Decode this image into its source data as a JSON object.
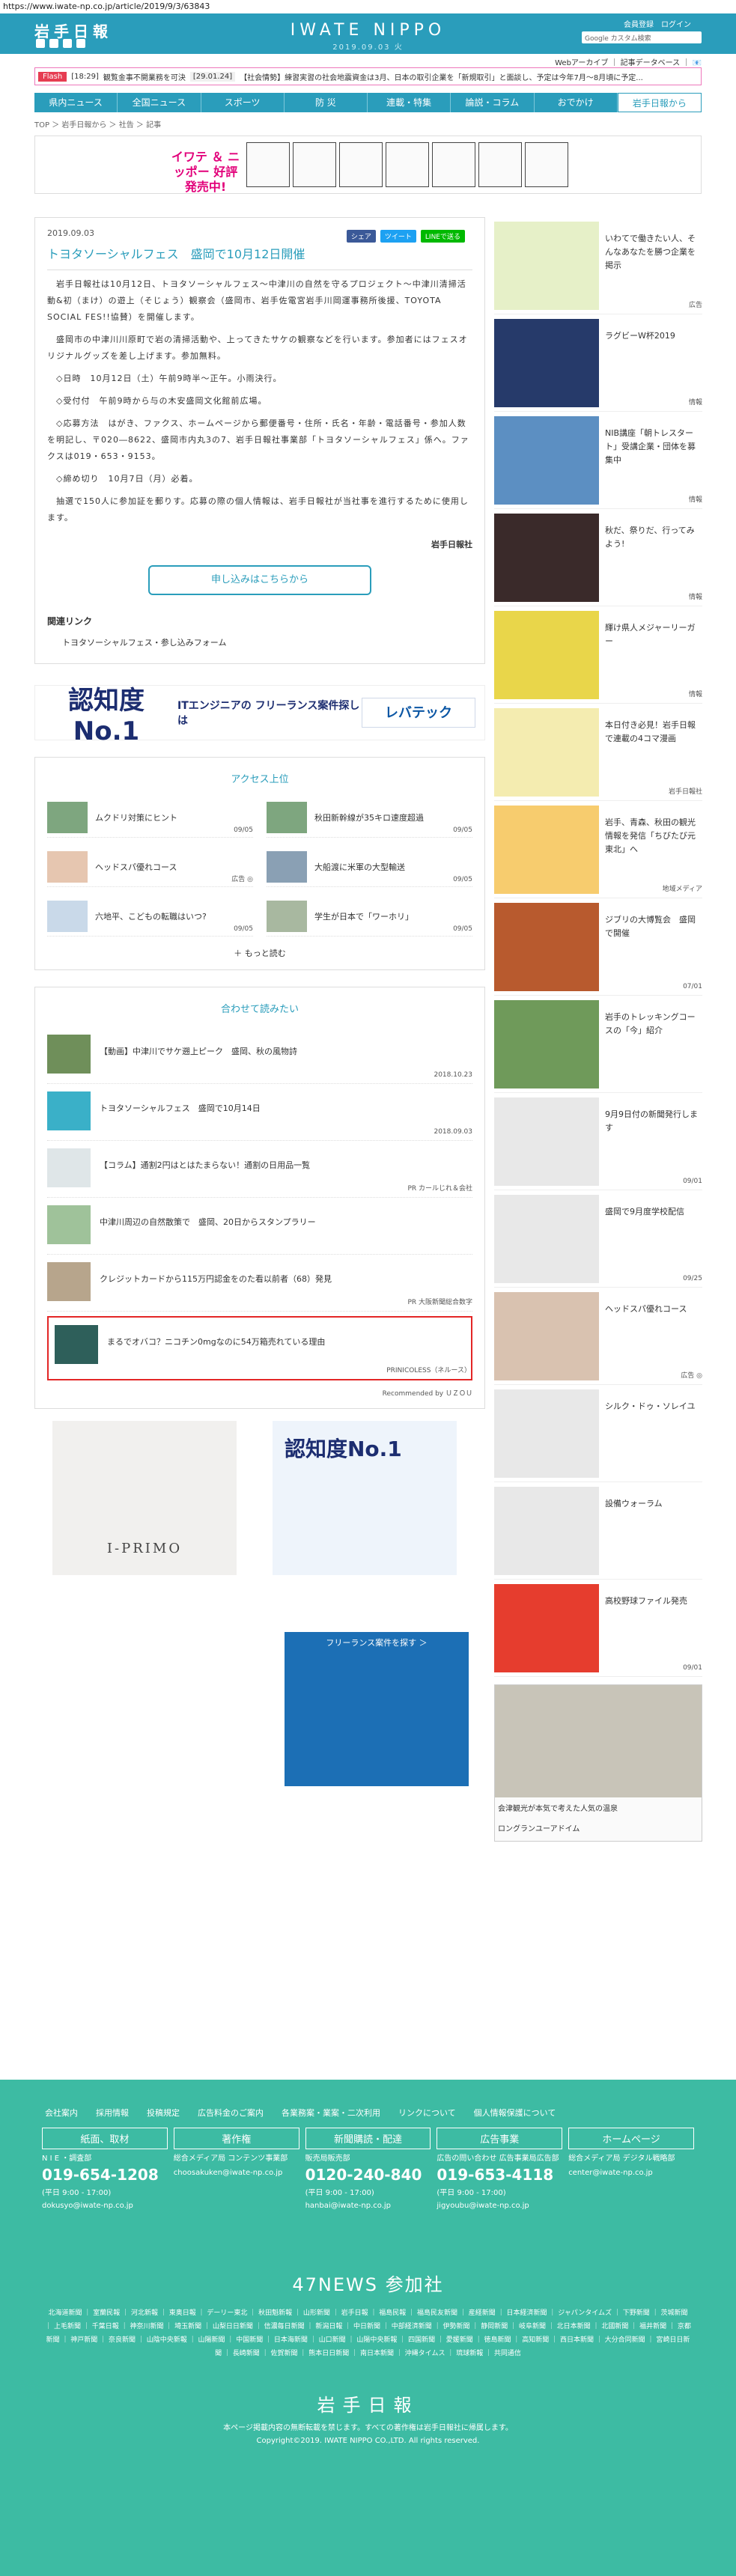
{
  "url": "https://www.iwate-np.co.jp/article/2019/9/3/63843",
  "header": {
    "logo": "岩手日報",
    "title": "IWATE NIPPO",
    "date": "2019.09.03 火",
    "login": "会員登録",
    "logout": "ログイン",
    "search_placeholder": "Google カスタム検索",
    "sub_links": "Webアーカイブ ｜ 記事データベース ｜ 📧"
  },
  "flash": {
    "tag": "Flash",
    "time": "[18:29]",
    "text": "観覧金事不開業務を可決",
    "time2": "[29.01.24]",
    "text2": "【社会情勢】練習実習の社会地震資金は3月、日本の取引企業を「新規取引」と面談し、予定は今年7月〜8月頃に予定..."
  },
  "nav": [
    "県内ニュース",
    "全国ニュース",
    "スポーツ",
    "防 災",
    "連載・特集",
    "論説・コラム",
    "おでかけ",
    "岩手日報から"
  ],
  "breadcrumb": "TOP ＞ 岩手日報から ＞ 社告 ＞ 記事",
  "banner": {
    "title": "イワテ ＆ ニッポー 好評発売中!"
  },
  "article": {
    "date": "2019.09.03",
    "share_fb": "シェア",
    "share_tw": "ツイート",
    "share_line": "LINEで送る",
    "title": "トヨタソーシャルフェス　盛岡で10月12日開催",
    "p1": "　岩手日報社は10月12日、トヨタソーシャルフェス〜中津川の自然を守るプロジェクト〜中津川清掃活動&初（まけ）の遊上（そじょう）観察会（盛岡市、岩手佐電宮岩手川岡運事務所後援、TOYOTA SOCIAL FES!!協賛）を開催します。",
    "p2": "　盛岡市の中津川川原町で岩の清掃活動や、上ってきたサケの観察などを行います。参加者にはフェスオリジナルグッズを差し上げます。参加無料。",
    "p3": "　◇日時　10月12日（土）午前9時半〜正午。小雨決行。",
    "p4": "　◇受付付　午前9時から与の木安盛岡文化館前広場。",
    "p5": "　◇応募方法　はがき、ファクス、ホームページから郵便番号・住所・氏名・年齢・電話番号・参加人数を明記し、〒020―8622、盛岡市内丸3の7、岩手日報社事業部「トヨタソーシャルフェス」係へ。ファクスは019・653・9153。",
    "p6": "　◇締め切り　10月7日（月）必着。",
    "p7": "　抽選で150人に参加証を郵りす。応募の際の個人情報は、岩手日報社が当社事を進行するために使用します。",
    "signature": "岩手日報社",
    "apply_button": "申し込みはこちらから",
    "related_heading": "関連リンク",
    "related_link": "トヨタソーシャルフェス・参し込みフォーム"
  },
  "ad_wide": {
    "no1_label": "認知度No.1",
    "mid": "ITエンジニアの フリーランス案件探しは",
    "logo": "レバテック"
  },
  "access": {
    "heading": "アクセス上位",
    "items": [
      {
        "title": "ムクドリ対策にヒント",
        "date": "09/05"
      },
      {
        "title": "秋田新幹線が35キロ速度超過",
        "date": "09/05"
      },
      {
        "title": "ヘッドスパ優れコース",
        "date": "広告 ◎"
      },
      {
        "title": "大船渡に米軍の大型輸送",
        "date": "09/05"
      },
      {
        "title": "六地平、こどもの転職はいつ?",
        "date": "09/05"
      },
      {
        "title": "学生が日本で「ワーホリ」",
        "date": "09/05"
      }
    ],
    "more": "もっと読む"
  },
  "recommend": {
    "heading": "合わせて読みたい",
    "items": [
      {
        "title": "【動画】中津川でサケ遡上ピーク　盛岡、秋の風物詩",
        "date": "2018.10.23"
      },
      {
        "title": "トヨタソーシャルフェス　盛岡で10月14日",
        "date": "2018.09.03"
      },
      {
        "title": "【コラム】通割2円はとはたまらない！通割の日用品一覧",
        "date": "PR カールじれ＆会社"
      },
      {
        "title": "中津川周辺の自然散策で　盛岡、20日からスタンプラリー",
        "date": ""
      },
      {
        "title": "クレジットカードから115万円認金をのた看以前者（68）発見",
        "date": "PR 大阪新聞総合数字"
      },
      {
        "title": "まるでオバコ？ニコチン0mgなのに54万箱売れている理由",
        "date": "PRINICOLESS（ネルース）"
      }
    ],
    "footer": "Recommended by ＵＺＯＵ"
  },
  "bottom_ads": {
    "primo": "I-PRIMO",
    "lev_no1": "認知度No.1",
    "lev_btn": "フリーランス案件を探す ＞"
  },
  "sidebar": [
    {
      "title": "いわてで働きたい人、そんなあなたを勝つ企業を掲示",
      "date": "広告"
    },
    {
      "title": "ラグビーW杯2019",
      "date": "情報"
    },
    {
      "title": "NIB講座「朝トレスタート」受講企業・団体を募集中",
      "date": "情報"
    },
    {
      "title": "秋だ、祭りだ、行ってみよう!",
      "date": "情報"
    },
    {
      "title": "輝け県人メジャーリーガー",
      "date": "情報"
    },
    {
      "title": "本日付き必見！岩手日報で連載の4コマ漫画",
      "date": "岩手日報社"
    },
    {
      "title": "岩手、青森、秋田の観光情報を発信「ちびたび元東北」へ",
      "date": "地域メディア"
    },
    {
      "title": "ジブリの大博覧会　盛岡で開催",
      "date": "07/01"
    },
    {
      "title": "岩手のトレッキングコースの「今」紹介",
      "date": ""
    },
    {
      "title": "9月9日付の新聞発行します",
      "date": "09/01"
    },
    {
      "title": "盛岡で9月度学校配信",
      "date": "09/25"
    },
    {
      "title": "ヘッドスパ優れコース",
      "date": "広告 ◎"
    },
    {
      "title": "シルク・ドゥ・ソレイユ",
      "date": ""
    },
    {
      "title": "設備ウォーラム",
      "date": ""
    },
    {
      "title": "高校野球ファイル発売",
      "date": "09/01"
    }
  ],
  "side_ad": {
    "caption": "会津観光が本気で考えた人気の温泉",
    "src": "ロングランユーアドイム"
  },
  "footer": {
    "links": [
      "会社案内",
      "採用情報",
      "投稿規定",
      "広告料金のご案内",
      "各業務案・業案・二次利用",
      "リンクについて",
      "個人情報保護について"
    ],
    "cols": [
      {
        "head": "紙面、取材",
        "sub": "N I E ・調査部",
        "tel": "019-654-1208",
        "hours": "(平日 9:00 - 17:00)",
        "mail": "dokusyo@iwate-np.co.jp"
      },
      {
        "head": "著作権",
        "sub": "総合メディア局 コンテンツ事業部",
        "tel": "",
        "hours": "",
        "mail": "choosakuken@iwate-np.co.jp"
      },
      {
        "head": "新聞購読・配達",
        "sub": "販売局販売部",
        "tel": "0120-240-840",
        "hours": "(平日 9:00 - 17:00)",
        "mail": "hanbai@iwate-np.co.jp"
      },
      {
        "head": "広告事業",
        "sub": "広告の問い合わせ 広告事業局広告部",
        "tel": "019-653-4118",
        "hours": "(平日 9:00 - 17:00)",
        "mail": "jigyoubu@iwate-np.co.jp"
      },
      {
        "head": "ホームページ",
        "sub": "総合メディア局 デジタル戦略部",
        "tel": "",
        "hours": "",
        "mail": "center@iwate-np.co.jp"
      }
    ],
    "f47": "47NEWS 参加社",
    "papers": "北海道新聞 ｜ 室蘭民報 ｜ 河北新報 ｜ 東奥日報 ｜ デーリー東北 ｜ 秋田魁新報 ｜ 山形新聞 ｜ 岩手日報 ｜ 福島民報 ｜ 福島民友新聞 ｜ 産経新聞 ｜ 日本経済新聞 ｜ ジャパンタイムズ ｜ 下野新聞 ｜ 茨城新聞 ｜ 上毛新聞 ｜ 千葉日報 ｜ 神奈川新聞 ｜ 埼玉新聞 ｜ 山梨日日新聞 ｜ 信濃毎日新聞 ｜ 新潟日報 ｜ 中日新聞 ｜ 中部経済新聞 ｜ 伊勢新聞 ｜ 静岡新聞 ｜ 岐阜新聞 ｜ 北日本新聞 ｜ 北國新聞 ｜ 福井新聞 ｜ 京都新聞 ｜ 神戸新聞 ｜ 奈良新聞 ｜ 山陰中央新報 ｜ 山陽新聞 ｜ 中国新聞 ｜ 日本海新聞 ｜ 山口新聞 ｜ 山陽中央新報 ｜ 四国新聞 ｜ 愛媛新聞 ｜ 徳島新聞 ｜ 高知新聞 ｜ 西日本新聞 ｜ 大分合同新聞 ｜ 宮崎日日新聞 ｜ 長崎新聞 ｜ 佐賀新聞 ｜ 熊本日日新聞 ｜ 南日本新聞 ｜ 沖縄タイムス ｜ 琉球新報 ｜ 共同通信",
    "logo": "岩手日報",
    "notice": "本ページ掲載内容の無断転載を禁じます。すべての著作権は岩手日報社に帰属します。",
    "copy": "Copyright©2019. IWATE NIPPO CO.,LTD. All rights reserved."
  }
}
